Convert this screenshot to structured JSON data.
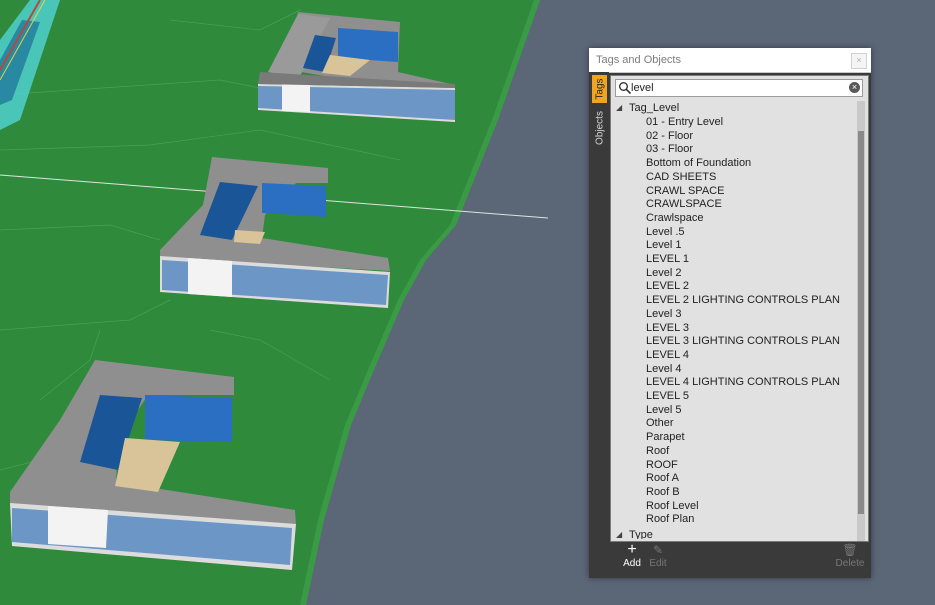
{
  "window": {
    "title": "Tags and Objects",
    "close_label": "×"
  },
  "side_tabs": [
    {
      "label": "Tags",
      "active": true
    },
    {
      "label": "Objects",
      "active": false
    }
  ],
  "search": {
    "value": "level",
    "clear_label": "×"
  },
  "tree": {
    "root": {
      "label": "Tag_Level",
      "expanded": true
    },
    "items": [
      "01 - Entry Level",
      "02 - Floor",
      "03 - Floor",
      "Bottom of Foundation",
      "CAD SHEETS",
      "CRAWL SPACE",
      "CRAWLSPACE",
      "Crawlspace",
      "Level .5",
      "Level 1",
      "LEVEL 1",
      "Level 2",
      "LEVEL 2",
      "LEVEL 2 LIGHTING CONTROLS PLAN",
      "Level 3",
      "LEVEL 3",
      "LEVEL 3 LIGHTING CONTROLS PLAN",
      "LEVEL 4",
      "Level 4",
      "LEVEL 4 LIGHTING CONTROLS PLAN",
      "LEVEL 5",
      "Level 5",
      "Other",
      "Parapet",
      "Roof",
      "ROOF",
      "Roof A",
      "Roof B",
      "Roof Level",
      "Roof Plan"
    ],
    "second_root": {
      "label": "Type",
      "expanded": false
    }
  },
  "toolbar": {
    "add_label": "Add",
    "add_icon": "plus-icon",
    "edit_label": "Edit",
    "edit_icon": "pencil-icon",
    "delete_label": "Delete",
    "delete_icon": "trash-icon"
  },
  "colors": {
    "accent": "#f1a51f",
    "ground": "#2f8a3b",
    "water": "#5b6677"
  }
}
